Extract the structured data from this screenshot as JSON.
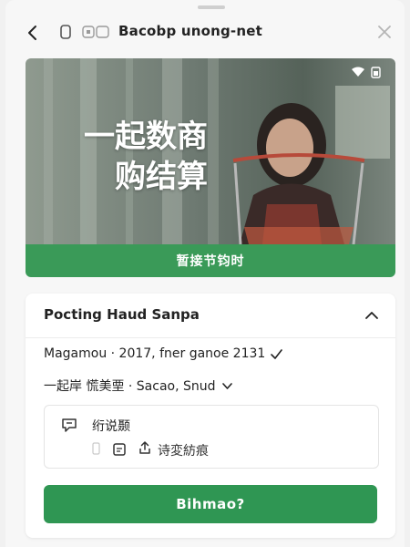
{
  "browser": {
    "url": "Bacobp unong-net"
  },
  "hero": {
    "headline_line1": "一起数商",
    "headline_line2": "购结算",
    "cta_label": "暂接节钧时"
  },
  "card": {
    "title": "Pocting Haud Sanpa",
    "row1_text": "Magamou · 2017, fner ganoe 2131",
    "row2_text": "一起岸 慌美垔 · Sacao, Snud",
    "sub_title": "绗说颞",
    "sub_action": "诗変紡痕",
    "primary_label": "Bihmao?"
  },
  "colors": {
    "accent_green": "#3a9a58",
    "button_green": "#2f9653"
  },
  "icons": [
    "back-arrow-icon",
    "tabs-icon",
    "reader-icon",
    "close-icon",
    "wifi-icon",
    "battery-icon",
    "chevron-up-icon",
    "check-icon",
    "chevron-down-icon",
    "comment-icon",
    "document-icon",
    "note-icon",
    "share-icon"
  ]
}
